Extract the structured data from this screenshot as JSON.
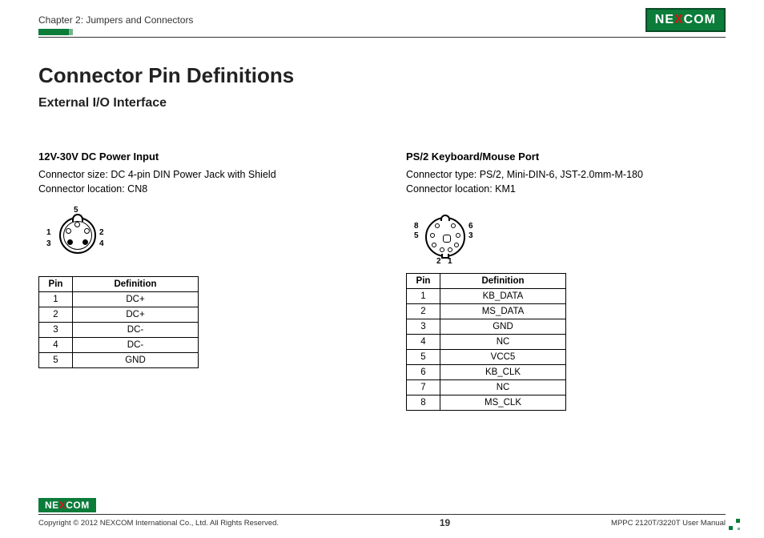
{
  "header": {
    "chapter": "Chapter 2: Jumpers and Connectors",
    "logo_text_a": "NE",
    "logo_text_x": "X",
    "logo_text_b": "COM"
  },
  "title": "Connector Pin Definitions",
  "subtitle": "External I/O Interface",
  "left": {
    "heading": "12V-30V DC Power Input",
    "line1": "Connector size: DC 4-pin DIN Power Jack with Shield",
    "line2": "Connector location: CN8",
    "labels": {
      "p1": "1",
      "p2": "2",
      "p3": "3",
      "p4": "4",
      "p5": "5"
    },
    "table_h1": "Pin",
    "table_h2": "Definition",
    "rows": [
      {
        "pin": "1",
        "def": "DC+"
      },
      {
        "pin": "2",
        "def": "DC+"
      },
      {
        "pin": "3",
        "def": "DC-"
      },
      {
        "pin": "4",
        "def": "DC-"
      },
      {
        "pin": "5",
        "def": "GND"
      }
    ]
  },
  "right": {
    "heading": "PS/2 Keyboard/Mouse Port",
    "line1": "Connector type: PS/2, Mini-DIN-6, JST-2.0mm-M-180",
    "line2": "Connector location: KM1",
    "labels": {
      "p1": "1",
      "p2": "2",
      "p3": "3",
      "p5": "5",
      "p6": "6",
      "p8": "8"
    },
    "table_h1": "Pin",
    "table_h2": "Definition",
    "rows": [
      {
        "pin": "1",
        "def": "KB_DATA"
      },
      {
        "pin": "2",
        "def": "MS_DATA"
      },
      {
        "pin": "3",
        "def": "GND"
      },
      {
        "pin": "4",
        "def": "NC"
      },
      {
        "pin": "5",
        "def": "VCC5"
      },
      {
        "pin": "6",
        "def": "KB_CLK"
      },
      {
        "pin": "7",
        "def": "NC"
      },
      {
        "pin": "8",
        "def": "MS_CLK"
      }
    ]
  },
  "footer": {
    "copyright": "Copyright © 2012 NEXCOM International Co., Ltd. All Rights Reserved.",
    "page": "19",
    "manual": "MPPC 2120T/3220T User Manual"
  }
}
